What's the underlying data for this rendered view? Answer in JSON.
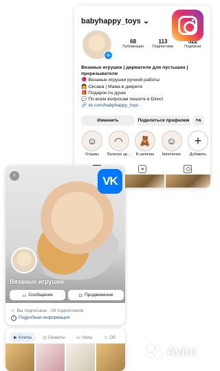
{
  "instagram": {
    "username": "babyhappy_toys",
    "username_chevron": "⌄",
    "stats": [
      {
        "value": "68",
        "label": "Публикации"
      },
      {
        "value": "113",
        "label": "Подписчики"
      },
      {
        "value": "522",
        "label": "Подписки"
      }
    ],
    "bio": {
      "name": "Вязаные игрушки | держатели для пустышек | прорезыватели",
      "lines": [
        "🧶 Вязаные игрушки ручной работы",
        "👩 Оксана | Мама в декрете",
        "🎁 Подарок по душе",
        "💬 По всем вопросам пишите в Direct"
      ],
      "link": "🔗 vk.com/babyhappy_toys"
    },
    "buttons": {
      "edit": "Изменить",
      "share": "Поделиться профилем",
      "add_user": "+ᴀ"
    },
    "highlights": [
      {
        "label": "Отзывы",
        "icon": "☺"
      },
      {
        "label": "Палитра цв...",
        "icon": "◠"
      },
      {
        "label": "В наличии",
        "icon": "🧸"
      },
      {
        "label": "Кипячение",
        "icon": "☺"
      },
      {
        "label": "Добавить",
        "icon": "+"
      }
    ]
  },
  "vk": {
    "logo": "VK",
    "back_icon": "‹",
    "group_name": "Вязаные игрушки",
    "buttons": {
      "messages": "Сообщения",
      "share": "Продвижение"
    },
    "subscribed_text": "Вы подписаны · 28 подписчиков",
    "more_info": "Подробная информация",
    "tabs": [
      {
        "label": "Клипы",
        "icon": "▶",
        "active": true
      },
      {
        "label": "Сюжеты",
        "icon": "◎",
        "active": false
      },
      {
        "label": "Чаты",
        "icon": "▭",
        "active": false
      },
      {
        "label": "Об",
        "icon": "☺",
        "active": false
      }
    ]
  },
  "watermark": {
    "brand": "Avito"
  },
  "colors": {
    "instagram_link": "#1b4e8a",
    "vk_blue": "#0077ff",
    "vk_link": "#2a5885",
    "ig_plus": "#1d8cf8"
  }
}
